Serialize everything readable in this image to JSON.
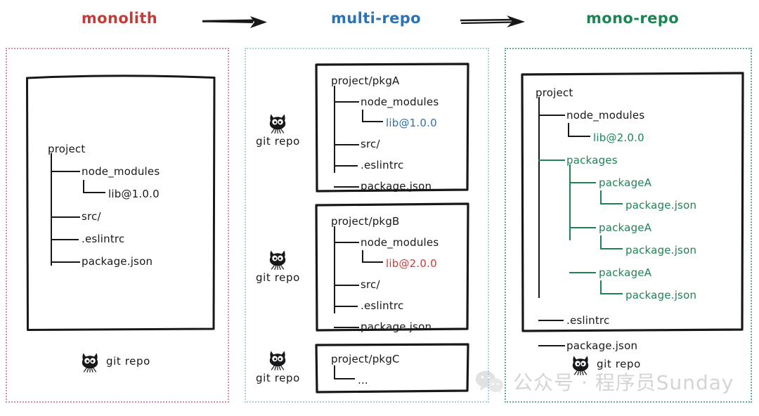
{
  "headings": {
    "monolith": "monolith",
    "multi_repo": "multi-repo",
    "mono_repo": "mono-repo"
  },
  "colors": {
    "monolith": "#c33c38",
    "multi_repo": "#2a74b5",
    "mono_repo": "#1d8453",
    "lib_v1": "#2a74b5",
    "lib_v2_red": "#d33a32",
    "panel_monolith_border": "#e0899a",
    "panel_multirepo_border": "#a9cfe2",
    "panel_monorepo_border": "#5fae8e",
    "text": "#17181a"
  },
  "git_repo_label": "git repo",
  "monolith_panel": {
    "tree": {
      "root": "project",
      "children": [
        "node_modules",
        "lib@1.0.0",
        "src/",
        ".eslintrc",
        "package.json"
      ]
    }
  },
  "multi_repo_panel": {
    "repos": [
      {
        "root": "project/pkgA",
        "children": [
          "node_modules",
          "lib@1.0.0",
          "src/",
          ".eslintrc",
          "package.json"
        ],
        "lib_version": "lib@1.0.0",
        "lib_color": "#2a74b5"
      },
      {
        "root": "project/pkgB",
        "children": [
          "node_modules",
          "lib@2.0.0",
          "src/",
          ".eslintrc",
          "package.json"
        ],
        "lib_version": "lib@2.0.0",
        "lib_color": "#d33a32"
      },
      {
        "root": "project/pkgC",
        "children": [
          "..."
        ]
      }
    ]
  },
  "mono_repo_panel": {
    "tree": {
      "root": "project",
      "node_modules": "node_modules",
      "lib": "lib@2.0.0",
      "packages": "packages",
      "package_a_1": "packageA",
      "package_json_1": "package.json",
      "package_a_2": "packageA",
      "package_json_2": "package.json",
      "package_a_3": "packageA",
      "package_json_3": "package.json",
      "eslintrc": ".eslintrc",
      "package_json_root": "package.json"
    }
  },
  "watermark": {
    "text": "公众号 · 程序员Sunday",
    "icon": "wechat-icon"
  },
  "icons": {
    "octocat": "github-octocat-icon",
    "arrow": "arrow-right-icon"
  }
}
